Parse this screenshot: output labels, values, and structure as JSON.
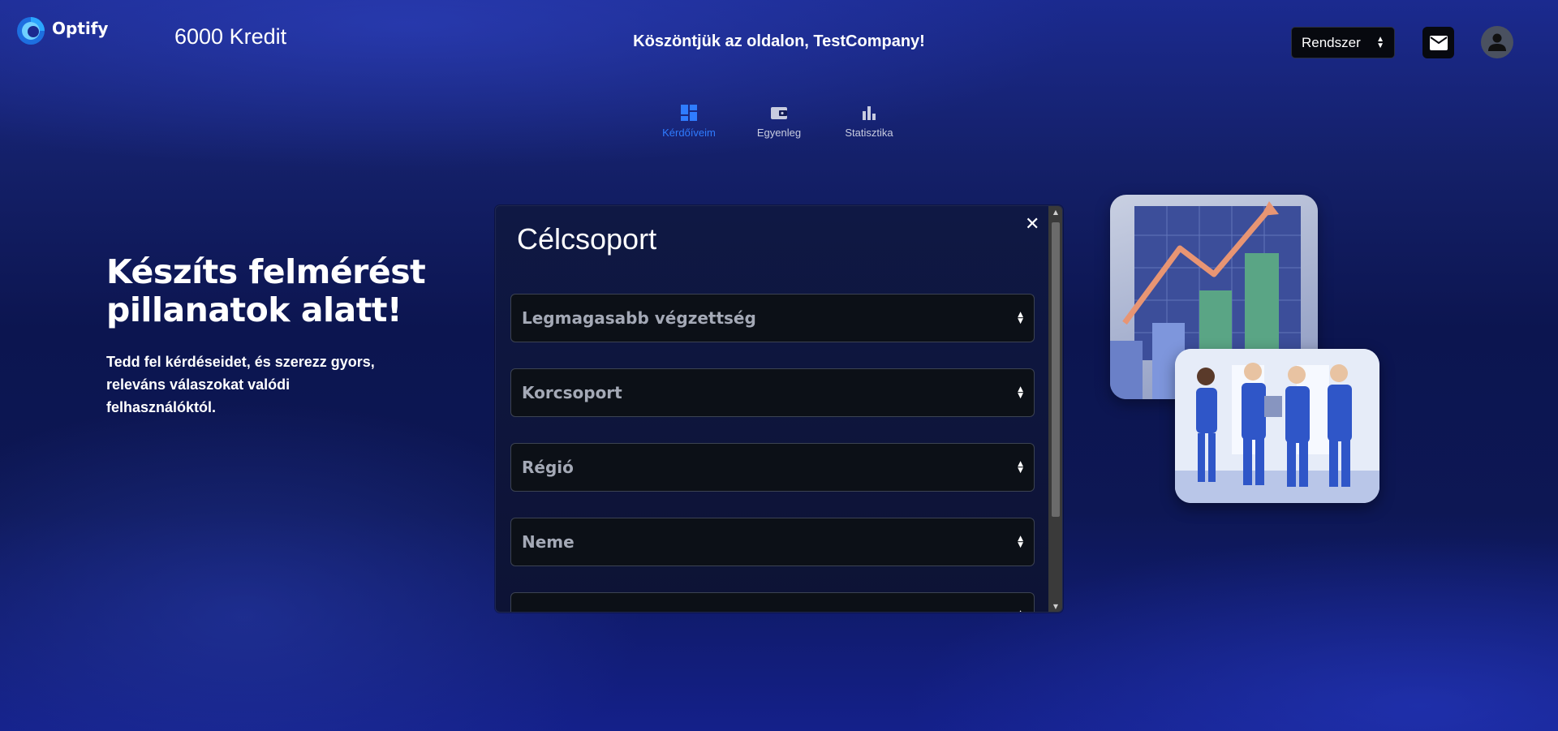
{
  "brand": {
    "name": "Optify"
  },
  "header": {
    "credits": "6000 Kredit",
    "welcome": "Köszöntjük az oldalon, TestCompany!",
    "system_select": "Rendszer"
  },
  "nav": {
    "items": [
      {
        "label": "Kérdőíveim",
        "icon": "dashboard-icon",
        "active": true
      },
      {
        "label": "Egyenleg",
        "icon": "wallet-icon",
        "active": false
      },
      {
        "label": "Statisztika",
        "icon": "bar-chart-icon",
        "active": false
      }
    ]
  },
  "hero": {
    "title_line1": "Készíts felmérést",
    "title_line2": "pillanatok alatt!",
    "subtitle": "Tedd fel kérdéseidet, és szerezz gyors, releváns válaszokat valódi felhasználóktól."
  },
  "modal": {
    "title": "Célcsoport",
    "fields": [
      {
        "label": "Legmagasabb végzettség"
      },
      {
        "label": "Korcsoport"
      },
      {
        "label": "Régió"
      },
      {
        "label": "Neme"
      }
    ]
  },
  "colors": {
    "accent": "#2f7cff",
    "background": "#0c1550",
    "field_bg": "#0c1017"
  }
}
